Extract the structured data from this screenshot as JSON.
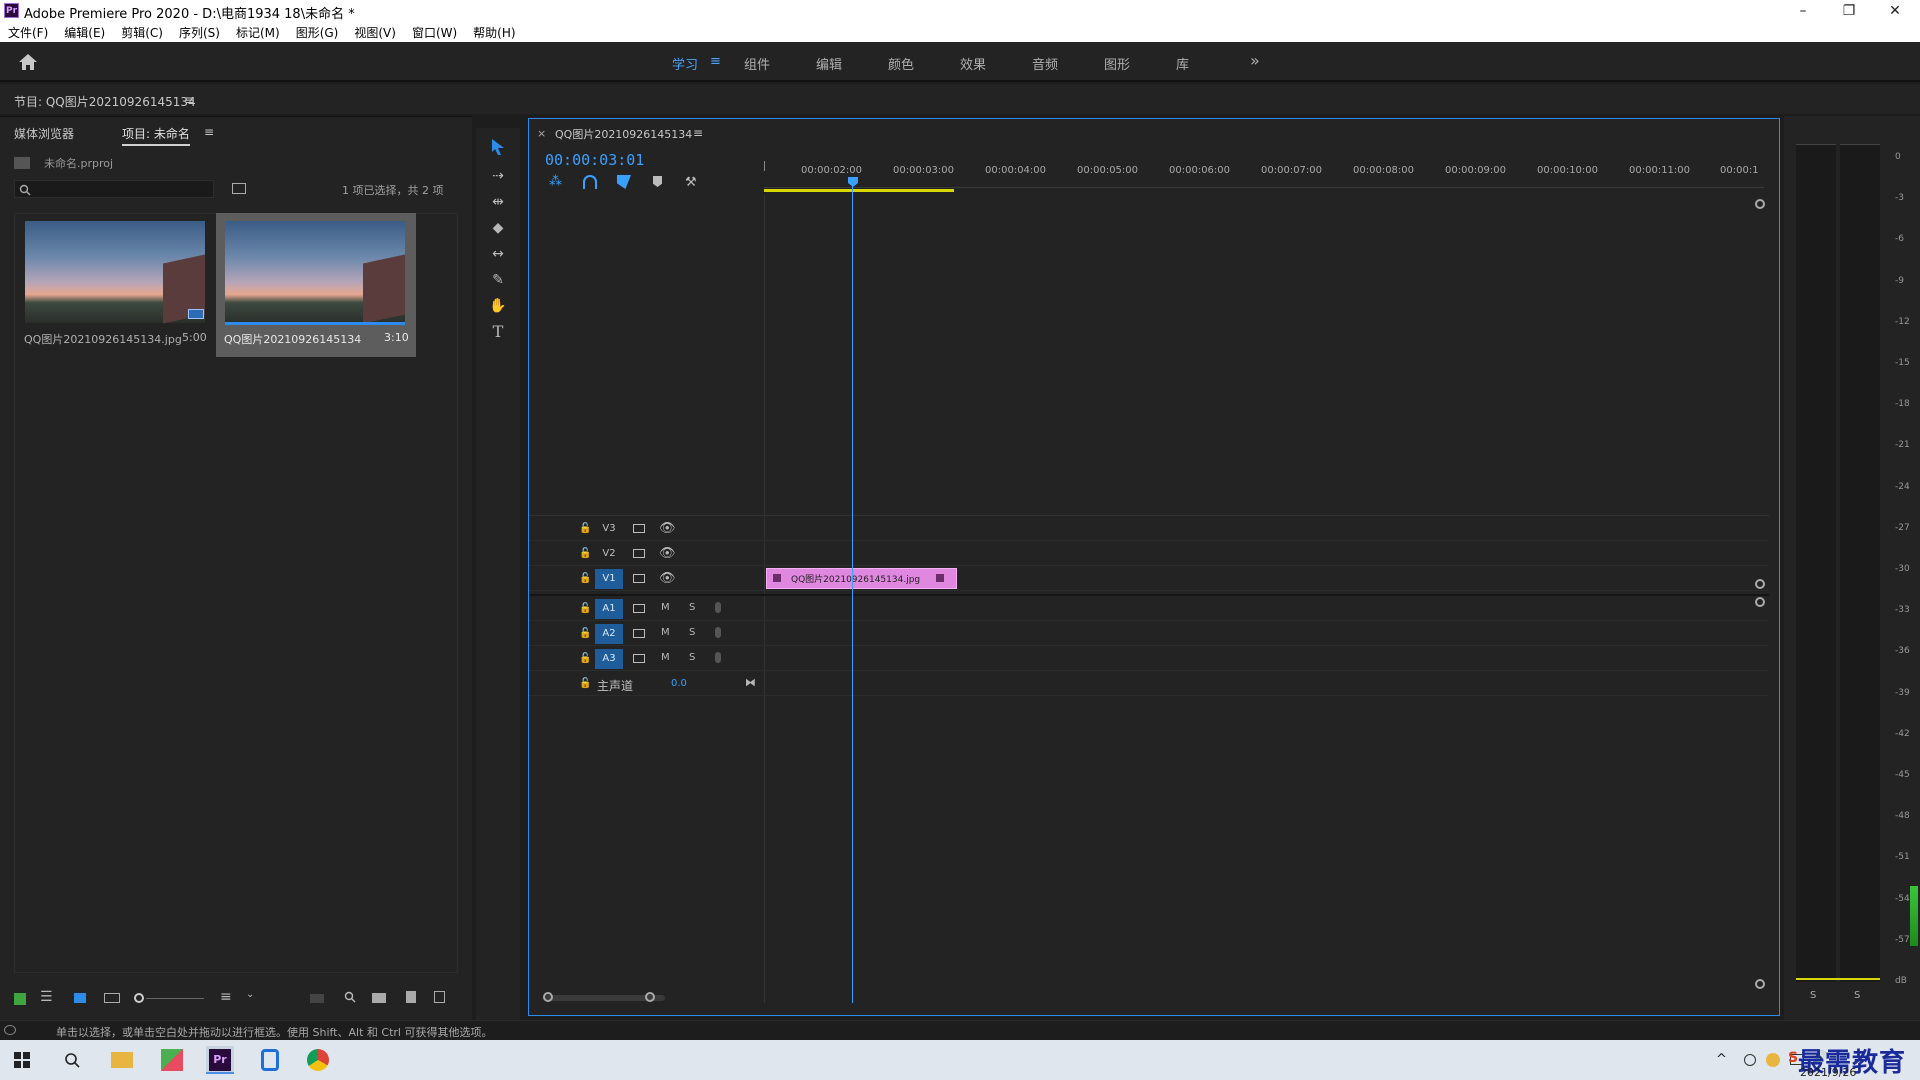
{
  "window": {
    "title": "Adobe Premiere Pro 2020 - D:\\电商1934 18\\未命名 *",
    "logo": "Pr",
    "minimize_icon": "–",
    "restore_icon": "❐",
    "close_icon": "✕"
  },
  "menu": [
    "文件(F)",
    "编辑(E)",
    "剪辑(C)",
    "序列(S)",
    "标记(M)",
    "图形(G)",
    "视图(V)",
    "窗口(W)",
    "帮助(H)"
  ],
  "workspaces": {
    "tabs": [
      "学习",
      "组件",
      "编辑",
      "颜色",
      "效果",
      "音频",
      "图形",
      "库"
    ],
    "active": "学习",
    "menu_icon": "≡",
    "more_icon": "»"
  },
  "program_monitor": {
    "title": "节目: QQ图片20210926145134",
    "menu_icon": "≡"
  },
  "project_panel": {
    "tabs": [
      "媒体浏览器",
      "项目: 未命名"
    ],
    "menu_icon": "≡",
    "project_file": "未命名.prproj",
    "selection_info": "1 项已选择，共 2 项",
    "items": [
      {
        "name": "QQ图片20210926145134.jpg",
        "duration": "5:00"
      },
      {
        "name": "QQ图片20210926145134",
        "duration": "3:10"
      }
    ]
  },
  "timeline": {
    "sequence_tab": "QQ图片20210926145134",
    "close_icon": "×",
    "menu_icon": "≡",
    "timecode": "00:00:03:01",
    "ruler": [
      "00:00:02:00",
      "00:00:03:00",
      "00:00:04:00",
      "00:00:05:00",
      "00:00:06:00",
      "00:00:07:00",
      "00:00:08:00",
      "00:00:09:00",
      "00:00:10:00",
      "00:00:11:00",
      "00:00:1"
    ],
    "video_tracks": [
      "V3",
      "V2",
      "V1"
    ],
    "audio_tracks": [
      "A1",
      "A2",
      "A3"
    ],
    "track_m": "M",
    "track_s": "S",
    "master_label": "主声道",
    "master_value": "0.0",
    "clip_label": "QQ图片20210926145134.jpg",
    "clip_color": "#e088e0"
  },
  "meters": {
    "labels": [
      "0",
      "-3",
      "-6",
      "-9",
      "-12",
      "-15",
      "-18",
      "-21",
      "-24",
      "-27",
      "-30",
      "-33",
      "-36",
      "-39",
      "-42",
      "-45",
      "-48",
      "-51",
      "-54",
      "-57",
      "dB"
    ],
    "solo_left": "S",
    "solo_right": "S"
  },
  "status_bar": {
    "text": "单击以选择，或单击空白处并拖动以进行框选。使用 Shift、Alt 和 Ctrl 可获得其他选项。"
  },
  "taskbar": {
    "clock_date": "2021/9/26",
    "watermark": "最需教育",
    "ime": "S"
  },
  "colors": {
    "accent": "#2d8ceb",
    "timecode": "#3aa0ff",
    "clip": "#e088e0",
    "active_track": "#1f5c9a"
  }
}
